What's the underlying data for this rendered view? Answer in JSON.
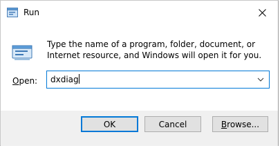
{
  "window": {
    "title": "Run",
    "icons": {
      "app": "run-icon",
      "close": "close-icon",
      "big": "run-icon"
    }
  },
  "dialog": {
    "description": "Type the name of a program, folder, document, or Internet resource, and Windows will open it for you.",
    "open_label": "Open:",
    "open_value": "dxdiag"
  },
  "buttons": {
    "ok": "OK",
    "cancel": "Cancel",
    "browse": "Browse..."
  },
  "colors": {
    "accent": "#0078d7",
    "footer": "#f0f0f0",
    "button_face": "#e1e1e1"
  }
}
